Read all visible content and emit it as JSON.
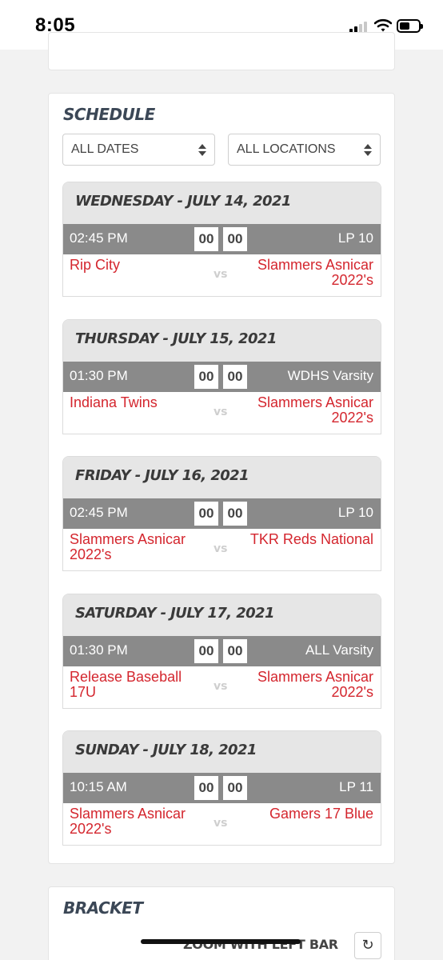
{
  "status_bar": {
    "time": "8:05"
  },
  "schedule": {
    "title": "SCHEDULE",
    "filters": {
      "dates": "ALL DATES",
      "locations": "ALL LOCATIONS"
    },
    "games": [
      {
        "date": "WEDNESDAY - JULY 14, 2021",
        "time": "02:45 PM",
        "home_score": "00",
        "away_score": "00",
        "location": "LP 10",
        "home_team": "Rip City",
        "away_team": "Slammers Asnicar 2022's",
        "vs": "vs"
      },
      {
        "date": "THURSDAY - JULY 15, 2021",
        "time": "01:30 PM",
        "home_score": "00",
        "away_score": "00",
        "location": "WDHS Varsity",
        "home_team": "Indiana Twins",
        "away_team": "Slammers Asnicar 2022's",
        "vs": "vs"
      },
      {
        "date": "FRIDAY - JULY 16, 2021",
        "time": "02:45 PM",
        "home_score": "00",
        "away_score": "00",
        "location": "LP 10",
        "home_team": "Slammers Asnicar 2022's",
        "away_team": "TKR Reds National",
        "vs": "vs"
      },
      {
        "date": "SATURDAY - JULY 17, 2021",
        "time": "01:30 PM",
        "home_score": "00",
        "away_score": "00",
        "location": "ALL Varsity",
        "home_team": "Release Baseball 17U",
        "away_team": "Slammers Asnicar 2022's",
        "vs": "vs"
      },
      {
        "date": "SUNDAY - JULY 18, 2021",
        "time": "10:15 AM",
        "home_score": "00",
        "away_score": "00",
        "location": "LP 11",
        "home_team": "Slammers Asnicar 2022's",
        "away_team": "Gamers 17 Blue",
        "vs": "vs"
      }
    ]
  },
  "bracket": {
    "title": "BRACKET",
    "zoom_label": "ZOOM WITH LEFT BAR",
    "refresh_icon": "refresh-icon"
  },
  "colors": {
    "team_link": "#d4262e",
    "date_header_bg": "#e6e6e6",
    "game_bar_bg": "#8a8a8a",
    "section_title": "#3b4756"
  }
}
